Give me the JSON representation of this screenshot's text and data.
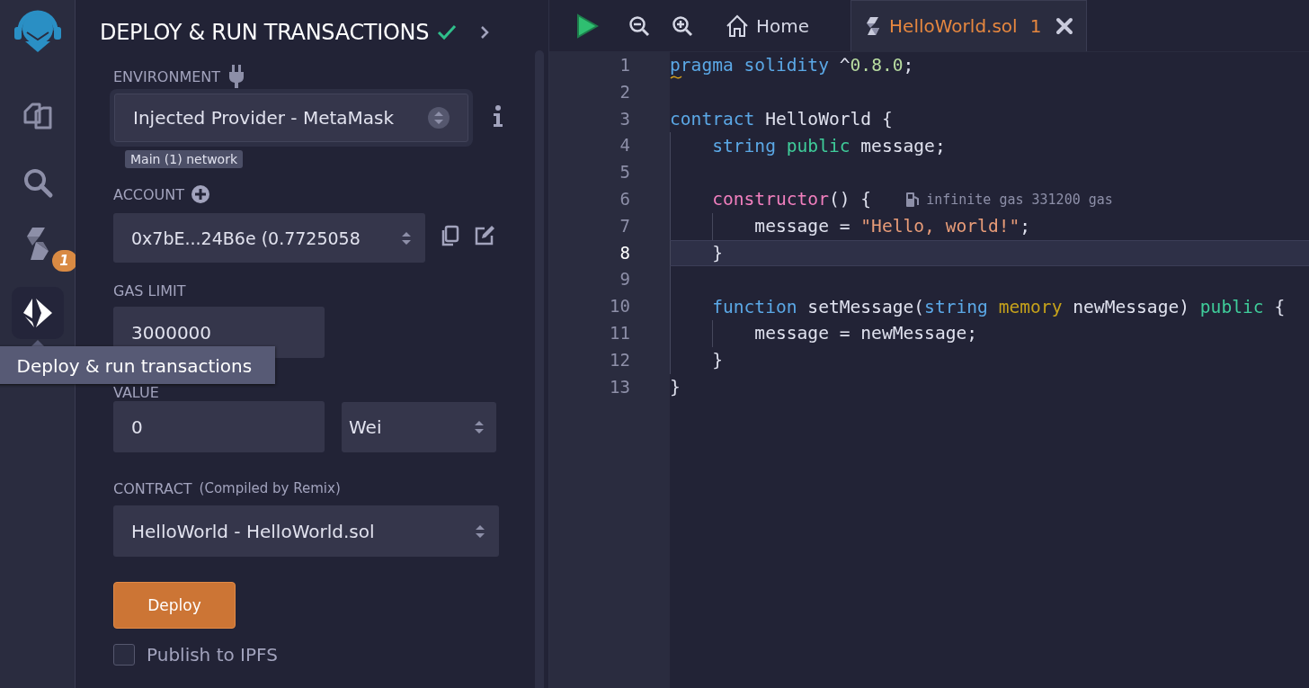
{
  "icon_bar": {
    "items": [
      {
        "kind": "logo"
      },
      {
        "kind": "files",
        "selected": false
      },
      {
        "kind": "search",
        "selected": false
      },
      {
        "kind": "solidity",
        "selected": false,
        "badge": "1"
      },
      {
        "kind": "deploy",
        "selected": true
      }
    ],
    "tooltip": "Deploy & run transactions"
  },
  "panel": {
    "title": "DEPLOY & RUN TRANSACTIONS",
    "environment": {
      "label": "ENVIRONMENT",
      "value": "Injected Provider - MetaMask",
      "network": "Main (1) network"
    },
    "account": {
      "label": "ACCOUNT",
      "value": "0x7bE...24B6e (0.7725058"
    },
    "gas_limit": {
      "label": "GAS LIMIT",
      "value": "3000000"
    },
    "value": {
      "label": "VALUE",
      "value": "0",
      "unit": "Wei"
    },
    "contract": {
      "label": "CONTRACT",
      "note": "(Compiled by Remix)",
      "value": "HelloWorld - HelloWorld.sol"
    },
    "deploy_button": "Deploy",
    "publish": {
      "label": "Publish to IPFS",
      "checked": false
    }
  },
  "editor": {
    "tabs": [
      {
        "kind": "home",
        "label": "Home",
        "selected": false
      },
      {
        "kind": "file",
        "label": "HelloWorld.sol",
        "selected": true,
        "badge": "1",
        "closable": true
      }
    ],
    "lines": [
      {
        "number": "1",
        "current": false,
        "warning": true,
        "tokens": [
          {
            "kind": "keyword",
            "text": "pragma solidity"
          },
          {
            "kind": "plain",
            "text": " ^"
          },
          {
            "kind": "number",
            "text": "0.8.0"
          },
          {
            "kind": "plain",
            "text": ";"
          }
        ]
      },
      {
        "number": "2",
        "current": false,
        "warning": false
      },
      {
        "number": "3",
        "current": false,
        "warning": false,
        "tokens": [
          {
            "kind": "keyword",
            "text": "contract"
          },
          {
            "kind": "plain",
            "text": " HelloWorld {"
          }
        ],
        "children": [
          {
            "number": "4",
            "current": false,
            "warning": false,
            "tokens": [
              {
                "kind": "keyword",
                "text": "string"
              },
              {
                "kind": "modifier",
                "text": " public"
              },
              {
                "kind": "plain",
                "text": " message;"
              }
            ]
          },
          {
            "number": "5",
            "current": false,
            "warning": false
          },
          {
            "number": "6",
            "current": false,
            "warning": false,
            "tokens": [
              {
                "kind": "constructor",
                "text": "constructor"
              },
              {
                "kind": "plain",
                "text": "() {"
              }
            ],
            "annotation": "infinite gas 331200 gas",
            "children": [
              {
                "number": "7",
                "current": false,
                "warning": false,
                "tokens": [
                  {
                    "kind": "plain",
                    "text": "message = "
                  },
                  {
                    "kind": "string",
                    "text": "\"Hello, world!\""
                  },
                  {
                    "kind": "plain",
                    "text": ";"
                  }
                ]
              }
            ]
          },
          {
            "number": "8",
            "current": true,
            "warning": false,
            "tokens": [
              {
                "kind": "plain",
                "text": "}"
              }
            ]
          },
          {
            "number": "9",
            "current": false,
            "warning": false
          },
          {
            "number": "10",
            "current": false,
            "warning": false,
            "tokens": [
              {
                "kind": "keyword",
                "text": "function"
              },
              {
                "kind": "plain",
                "text": " setMessage("
              },
              {
                "kind": "keyword",
                "text": "string"
              },
              {
                "kind": "storage",
                "text": " memory"
              },
              {
                "kind": "plain",
                "text": " newMessage)"
              },
              {
                "kind": "modifier",
                "text": " public"
              },
              {
                "kind": "plain",
                "text": " {"
              }
            ],
            "children": [
              {
                "number": "11",
                "current": false,
                "warning": false,
                "tokens": [
                  {
                    "kind": "plain",
                    "text": "message = newMessage;"
                  }
                ]
              }
            ]
          },
          {
            "number": "12",
            "current": false,
            "warning": false,
            "tokens": [
              {
                "kind": "plain",
                "text": "}"
              }
            ]
          }
        ]
      },
      {
        "number": "13",
        "current": false,
        "warning": false,
        "tokens": [
          {
            "kind": "plain",
            "text": "}"
          }
        ]
      }
    ]
  }
}
